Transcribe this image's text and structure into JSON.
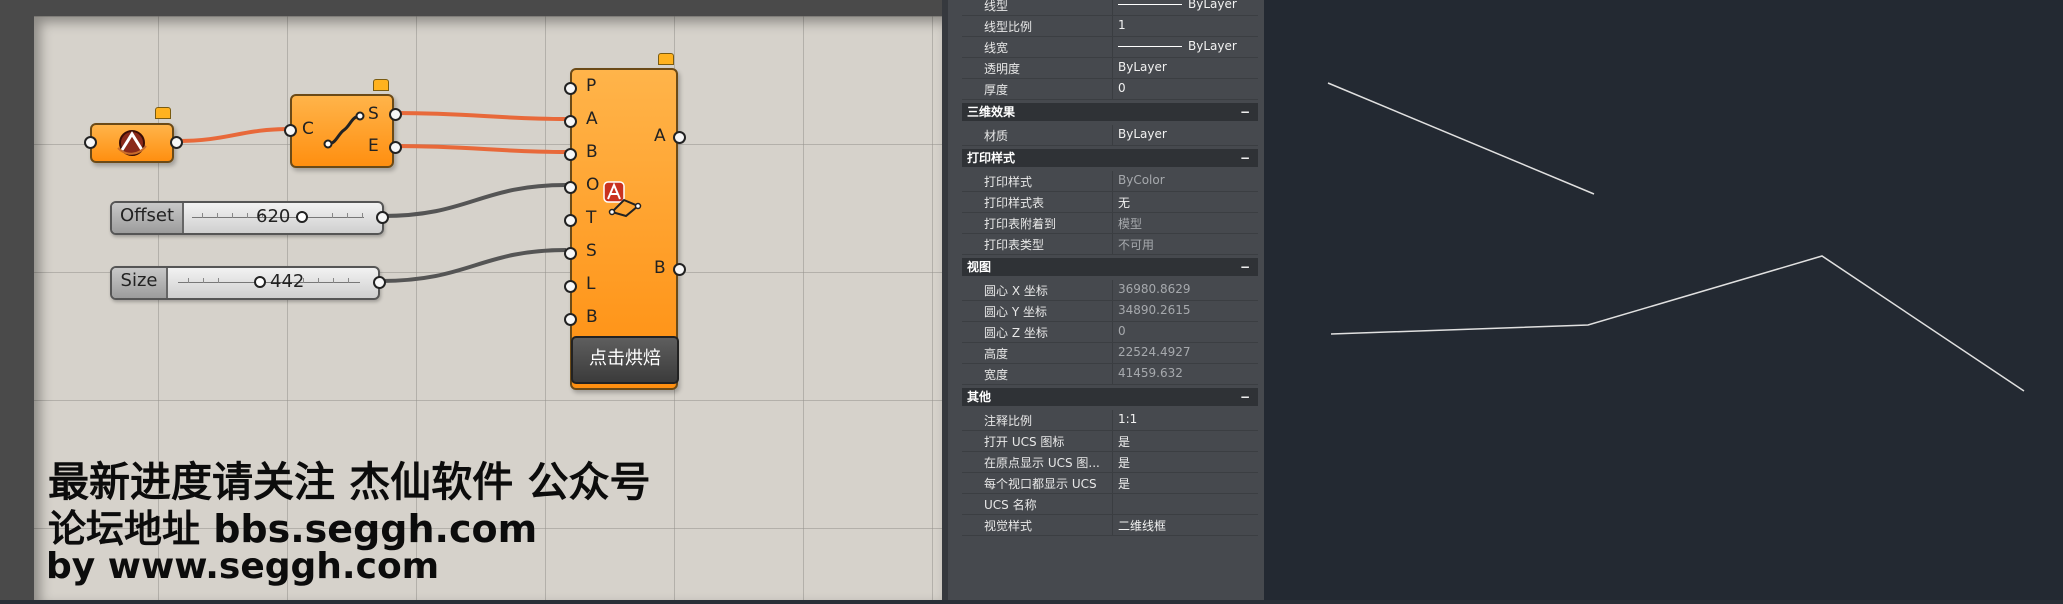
{
  "grasshopper": {
    "slider_offset": {
      "name": "Offset",
      "value": "620"
    },
    "slider_size": {
      "name": "Size",
      "value": "442"
    },
    "curve_node": {
      "input": "C",
      "outputs": [
        "S",
        "E"
      ]
    },
    "main_node": {
      "inputs": [
        "P",
        "A",
        "B",
        "O",
        "T",
        "S",
        "L",
        "B"
      ],
      "outputs": [
        "A",
        "B"
      ],
      "button": "点击烘焙"
    },
    "overlay": {
      "line1": "最新进度请关注 杰仙软件 公众号",
      "line2": "论坛地址 bbs.seggh.com",
      "line3": "by www.seggh.com"
    },
    "colors": {
      "canvas": "#d6d2cb",
      "node": "#ff9a1f",
      "wire_curve": "#e8693a",
      "wire_num": "#555555"
    }
  },
  "properties": {
    "top_rows": [
      {
        "k": "线型",
        "v": "ByLayer",
        "line": true
      },
      {
        "k": "线型比例",
        "v": "1"
      },
      {
        "k": "线宽",
        "v": "ByLayer",
        "line": true
      },
      {
        "k": "透明度",
        "v": "ByLayer"
      },
      {
        "k": "厚度",
        "v": "0"
      }
    ],
    "sections": [
      {
        "title": "三维效果",
        "minus": "−",
        "rows": [
          {
            "k": "材质",
            "v": "ByLayer"
          }
        ]
      },
      {
        "title": "打印样式",
        "minus": "−",
        "rows": [
          {
            "k": "打印样式",
            "v": "ByColor",
            "dim": true
          },
          {
            "k": "打印样式表",
            "v": "无"
          },
          {
            "k": "打印表附着到",
            "v": "模型",
            "dim": true
          },
          {
            "k": "打印表类型",
            "v": "不可用",
            "dim": true
          }
        ]
      },
      {
        "title": "视图",
        "minus": "−",
        "rows": [
          {
            "k": "圆心 X 坐标",
            "v": "36980.8629",
            "dim": true
          },
          {
            "k": "圆心 Y 坐标",
            "v": "34890.2615",
            "dim": true
          },
          {
            "k": "圆心 Z 坐标",
            "v": "0",
            "dim": true
          },
          {
            "k": "高度",
            "v": "22524.4927",
            "dim": true
          },
          {
            "k": "宽度",
            "v": "41459.632",
            "dim": true
          }
        ]
      },
      {
        "title": "其他",
        "minus": "−",
        "rows": [
          {
            "k": "注释比例",
            "v": "1:1"
          },
          {
            "k": "打开 UCS 图标",
            "v": "是"
          },
          {
            "k": "在原点显示 UCS 图...",
            "v": "是"
          },
          {
            "k": "每个视口都显示 UCS",
            "v": "是"
          },
          {
            "k": "UCS 名称",
            "v": ""
          },
          {
            "k": "视觉样式",
            "v": "二维线框"
          }
        ]
      }
    ]
  },
  "cad_view": {
    "background": "#232932",
    "line_color": "#e0e0e0"
  }
}
